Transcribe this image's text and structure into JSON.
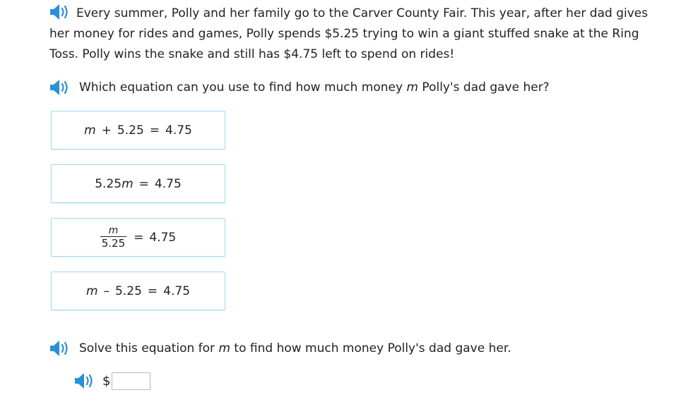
{
  "intro": {
    "text": "Every summer, Polly and her family go to the Carver County Fair. This year, after her dad gives her money for rides and games, Polly spends $5.25 trying to win a giant stuffed snake at the Ring Toss. Polly wins the snake and still has $4.75 left to spend on rides!"
  },
  "question1": {
    "before": "Which equation can you use to find how much money ",
    "variable": "m",
    "after": " Polly's dad gave her?"
  },
  "choices": [
    {
      "var": "m",
      "op": "+",
      "num": "5.25",
      "eq": "=",
      "rhs": "4.75"
    },
    {
      "coef": "5.25",
      "var": "m",
      "eq": "=",
      "rhs": "4.75"
    },
    {
      "numerator": "m",
      "denominator": "5.25",
      "eq": "=",
      "rhs": "4.75"
    },
    {
      "var": "m",
      "op": "–",
      "num": "5.25",
      "eq": "=",
      "rhs": "4.75"
    }
  ],
  "question2": {
    "before": "Solve this equation for ",
    "variable": "m",
    "after": " to find how much money Polly's dad gave her."
  },
  "answer": {
    "currency": "$",
    "value": ""
  },
  "colors": {
    "speaker": "#2b8fd6",
    "choice_border": "#9fd9ee"
  },
  "icons": [
    "speaker-icon"
  ]
}
